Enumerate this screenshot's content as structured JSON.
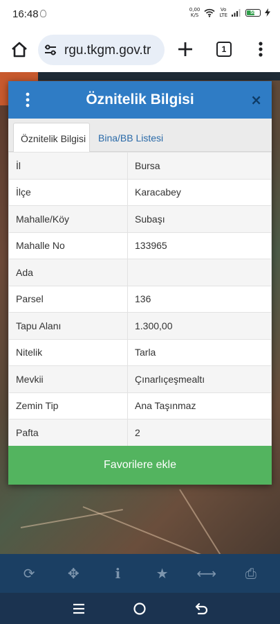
{
  "status_bar": {
    "time": "16:48",
    "net_speed_value": "0,00",
    "net_speed_unit": "K/S",
    "volte_top": "Vo",
    "volte_bottom": "LTE",
    "battery": "55",
    "battery_level": 0.55
  },
  "browser": {
    "url": "rgu.tkgm.gov.tr",
    "tab_count": "1",
    "icons": [
      "home-icon",
      "site-settings-icon",
      "plus-icon",
      "tabs-icon",
      "more-vert-icon"
    ]
  },
  "modal": {
    "title": "Öznitelik Bilgisi",
    "close": "×",
    "tabs": [
      {
        "label": "Öznitelik Bilgisi",
        "active": true
      },
      {
        "label": "Bina/BB Listesi",
        "active": false
      }
    ],
    "rows": [
      {
        "key": "İl",
        "value": "Bursa"
      },
      {
        "key": "İlçe",
        "value": "Karacabey"
      },
      {
        "key": "Mahalle/Köy",
        "value": "Subaşı"
      },
      {
        "key": "Mahalle No",
        "value": "133965"
      },
      {
        "key": "Ada",
        "value": ""
      },
      {
        "key": "Parsel",
        "value": "136"
      },
      {
        "key": "Tapu Alanı",
        "value": "1.300,00"
      },
      {
        "key": "Nitelik",
        "value": "Tarla"
      },
      {
        "key": "Mevkii",
        "value": "Çınarlıçeşmealtı"
      },
      {
        "key": "Zemin Tip",
        "value": "Ana Taşınmaz"
      },
      {
        "key": "Pafta",
        "value": "2"
      }
    ],
    "favorite_button": "Favorilere ekle"
  },
  "map_toolbar": {
    "tools": [
      {
        "name": "refresh-icon",
        "glyph": "⟳"
      },
      {
        "name": "locate-icon",
        "glyph": "✥"
      },
      {
        "name": "info-icon",
        "glyph": "i"
      },
      {
        "name": "star-icon",
        "glyph": "★"
      },
      {
        "name": "measure-icon",
        "glyph": "⟷"
      },
      {
        "name": "print-icon",
        "glyph": "⎙"
      }
    ]
  },
  "nav_bar": {
    "icons": [
      "recents-icon",
      "home-circle-icon",
      "back-icon"
    ]
  },
  "colors": {
    "modal_header": "#2f7cc5",
    "favorite_button": "#53b45f",
    "map_toolbar": "#1b3f63",
    "nav_bar": "#1b3350",
    "tab_link": "#2a6aa8"
  }
}
